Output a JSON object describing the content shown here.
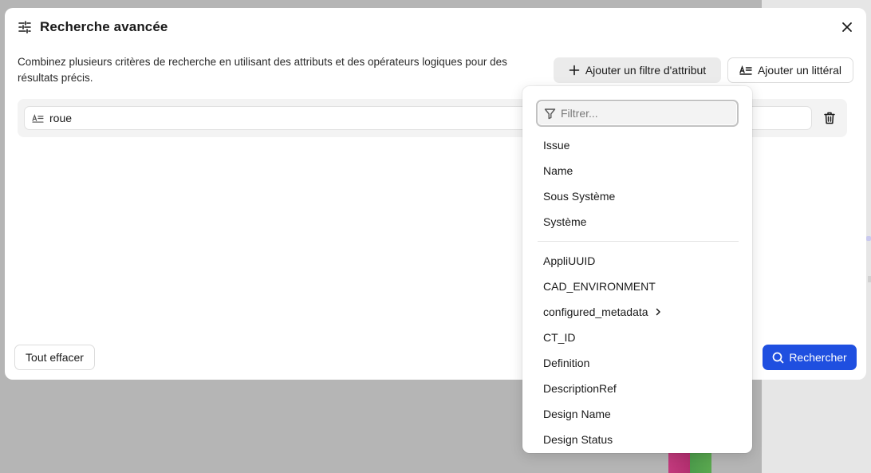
{
  "dialog": {
    "title": "Recherche avancée",
    "description": "Combinez plusieurs critères de recherche en utilisant des attributs et des opérateurs logiques pour des résultats précis.",
    "add_attribute_filter_label": "Ajouter un filtre d'attribut",
    "add_literal_label": "Ajouter un littéral",
    "clear_all_label": "Tout effacer",
    "search_label": "Rechercher"
  },
  "criteria": {
    "literal_value": "roue"
  },
  "dropdown": {
    "filter_placeholder": "Filtrer...",
    "primary_items": [
      "Issue",
      "Name",
      "Sous Système",
      "Système"
    ],
    "secondary_items": [
      "AppliUUID",
      "CAD_ENVIRONMENT",
      "configured_metadata",
      "CT_ID",
      "Definition",
      "DescriptionRef",
      "Design Name",
      "Design Status"
    ]
  },
  "colors": {
    "accent": "#1f4fe0",
    "backdrop": "#b5b5b5",
    "row_bg": "#f3f3f3"
  },
  "icons": {
    "title": "sliders-icon",
    "close": "close-icon",
    "add": "plus-icon",
    "literal": "text-literal-icon",
    "delete": "trash-icon",
    "search": "search-icon",
    "filter": "funnel-icon",
    "submenu": "chevron-right-icon"
  }
}
